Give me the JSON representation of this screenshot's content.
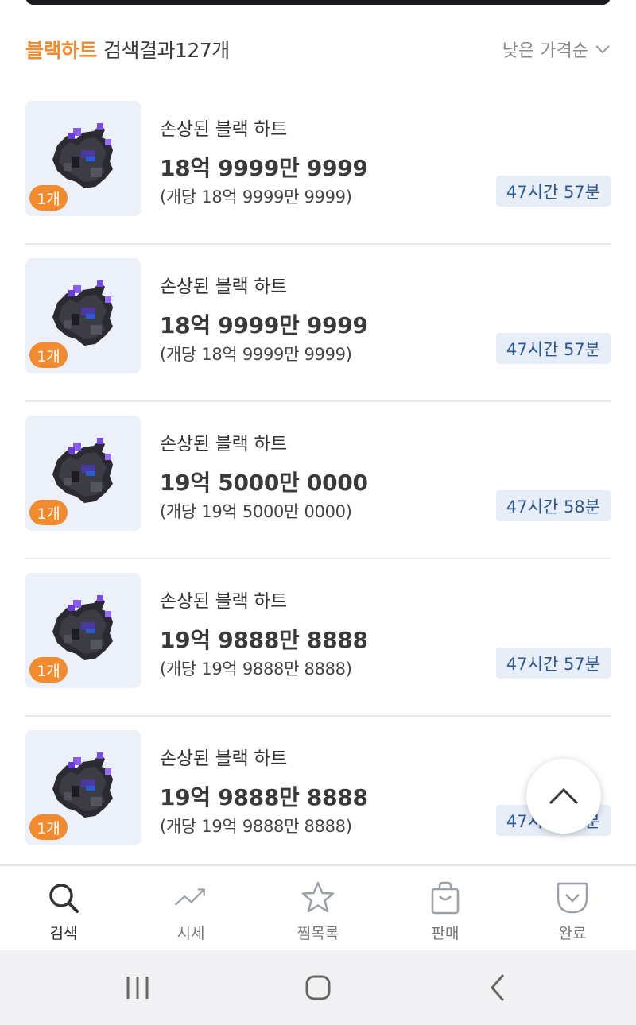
{
  "header": {
    "keyword": "블랙하트",
    "result_label": "검색결과",
    "result_count": "127개",
    "sort_label": "낮은 가격순"
  },
  "items": [
    {
      "name": "손상된 블랙 하트",
      "price": "18억 9999만 9999",
      "unit_price": "(개당 18억 9999만 9999)",
      "quantity": "1개",
      "time_left": "47시간 57분"
    },
    {
      "name": "손상된 블랙 하트",
      "price": "18억 9999만 9999",
      "unit_price": "(개당 18억 9999만 9999)",
      "quantity": "1개",
      "time_left": "47시간 57분"
    },
    {
      "name": "손상된 블랙 하트",
      "price": "19억 5000만 0000",
      "unit_price": "(개당 19억 5000만 0000)",
      "quantity": "1개",
      "time_left": "47시간 58분"
    },
    {
      "name": "손상된 블랙 하트",
      "price": "19억 9888만 8888",
      "unit_price": "(개당 19억 9888만 8888)",
      "quantity": "1개",
      "time_left": "47시간 57분"
    },
    {
      "name": "손상된 블랙 하트",
      "price": "19억 9888만 8888",
      "unit_price": "(개당 19억 9888만 8888)",
      "quantity": "1개",
      "time_left": "47시간 57분"
    }
  ],
  "nav": [
    {
      "label": "검색",
      "icon": "search-icon",
      "active": true
    },
    {
      "label": "시세",
      "icon": "trend-chart-icon",
      "active": false
    },
    {
      "label": "찜목록",
      "icon": "star-icon",
      "active": false
    },
    {
      "label": "판매",
      "icon": "shopping-bag-icon",
      "active": false
    },
    {
      "label": "완료",
      "icon": "check-pocket-icon",
      "active": false
    }
  ],
  "colors": {
    "accent": "#f28a2e",
    "time_badge_bg": "#e8eef8",
    "time_badge_text": "#2d5694"
  }
}
